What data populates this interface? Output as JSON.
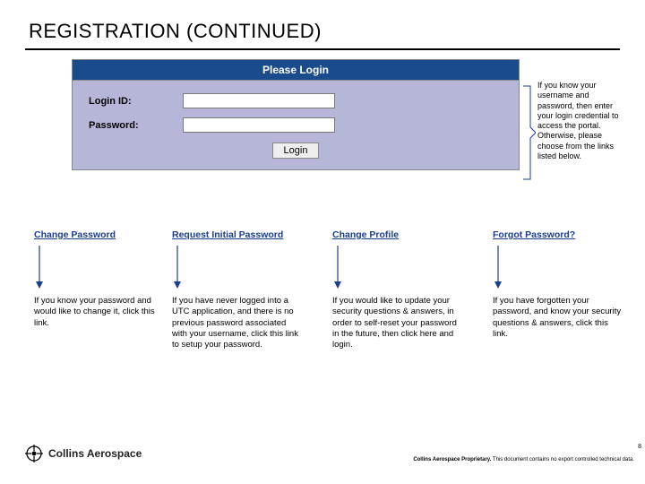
{
  "title": "REGISTRATION (CONTINUED)",
  "login": {
    "header": "Please Login",
    "id_label": "Login ID:",
    "pw_label": "Password:",
    "button": "Login"
  },
  "side_note": "If you know your username and password, then enter your login credential to access the portal. Otherwise, please choose from the links listed below.",
  "links": {
    "change_password": {
      "label": "Change Password",
      "desc": "If you know your password and would like to change it, click this link."
    },
    "request_initial": {
      "label": "Request Initial Password",
      "desc": "If you have never logged into a UTC application, and there is no previous password associated with your username, click this link to setup your password."
    },
    "change_profile": {
      "label": "Change Profile",
      "desc": "If you would like to update your security questions & answers, in order to self-reset your password in the future, then click here and login."
    },
    "forgot": {
      "label": "Forgot Password?",
      "desc": "If you have forgotten your password, and know your security questions & answers, click this link."
    }
  },
  "footer": {
    "company": "Collins Aerospace",
    "legal_bold": "Collins Aerospace Proprietary.",
    "legal_rest": " This document contains no export controlled technical data.",
    "page": "8"
  }
}
